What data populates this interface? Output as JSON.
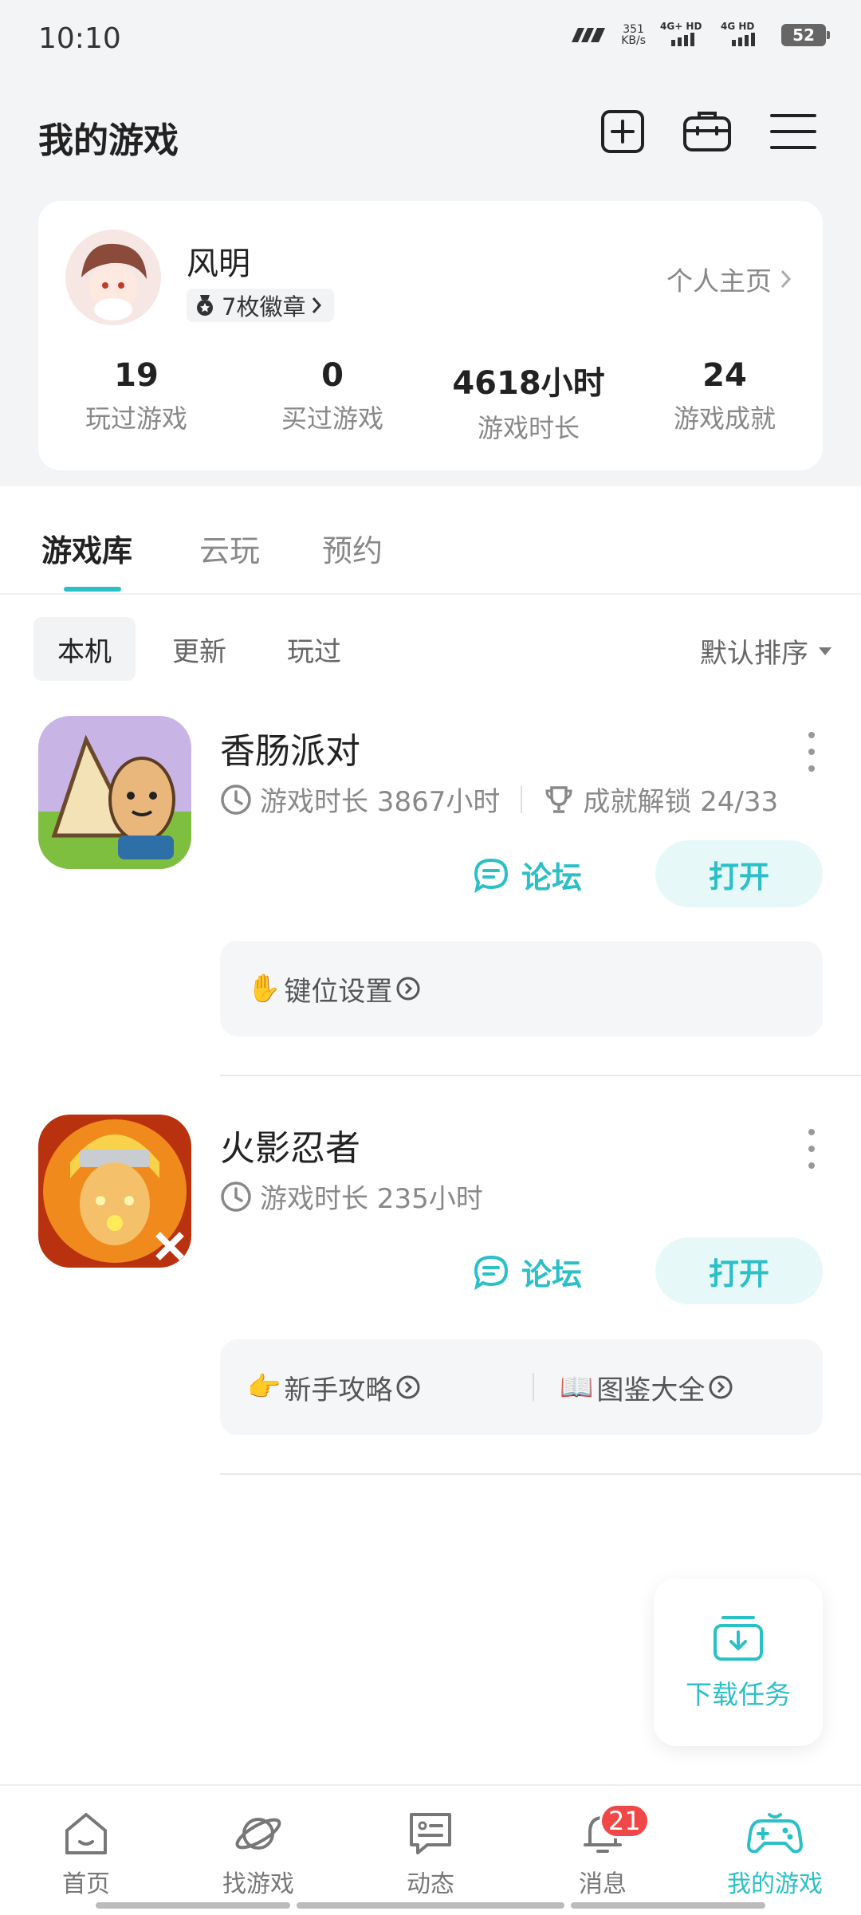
{
  "status_bar": {
    "time": "10:10",
    "speed_value": "351",
    "speed_unit": "KB/s",
    "sim1_label": "4G+ HD",
    "sim2_label": "4G HD",
    "battery": "52"
  },
  "header": {
    "title": "我的游戏",
    "icons": [
      "add-square-icon",
      "toolbox-icon",
      "menu-icon"
    ]
  },
  "profile": {
    "username": "风明",
    "badge_text": "7枚徽章",
    "home_link": "个人主页",
    "stats": [
      {
        "value": "19",
        "label": "玩过游戏"
      },
      {
        "value": "0",
        "label": "买过游戏"
      },
      {
        "value": "4618小时",
        "label": "游戏时长"
      },
      {
        "value": "24",
        "label": "游戏成就"
      }
    ]
  },
  "tabs": [
    "游戏库",
    "云玩",
    "预约"
  ],
  "filters": {
    "chips": [
      "本机",
      "更新",
      "玩过"
    ],
    "sort_label": "默认排序"
  },
  "games": [
    {
      "name": "香肠派对",
      "playtime": "游戏时长 3867小时",
      "achievement": "成就解锁 24/33",
      "forum_label": "论坛",
      "open_label": "打开",
      "sub_links": [
        {
          "emoji": "✋",
          "label": "键位设置"
        }
      ]
    },
    {
      "name": "火影忍者",
      "playtime": "游戏时长 235小时",
      "forum_label": "论坛",
      "open_label": "打开",
      "sub_links": [
        {
          "emoji": "👉",
          "label": "新手攻略"
        },
        {
          "emoji": "📖",
          "label": "图鉴大全"
        }
      ]
    }
  ],
  "download_float": {
    "label": "下载任务"
  },
  "bottom_nav": {
    "items": [
      "首页",
      "找游戏",
      "动态",
      "消息",
      "我的游戏"
    ],
    "message_badge": "21"
  },
  "colors": {
    "accent": "#2bbfc7",
    "badge_red": "#f04848",
    "background": "#f3f4f6"
  }
}
